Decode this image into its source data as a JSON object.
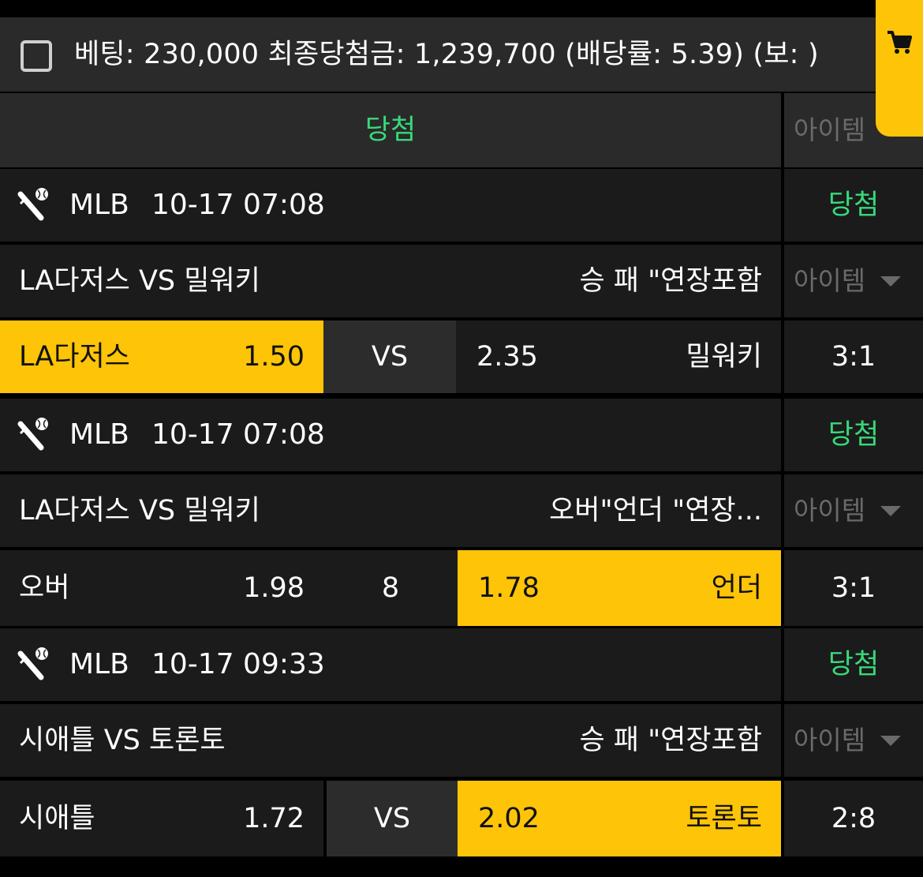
{
  "summary": {
    "text": "베팅: 230,000 최종당첨금: 1,239,700 (배당률: 5.39) (보: )"
  },
  "status_header": {
    "result_label": "당첨",
    "item_label": "아이템"
  },
  "colors": {
    "win_green": "#38d97a",
    "selected_yellow": "#fec407",
    "row_bg": "#1b1b1b",
    "header_bg": "#2a2a2a"
  },
  "bets": [
    {
      "league": "MLB",
      "datetime": "10-17 07:08",
      "result": "당첨",
      "match_title": "LA다저스 VS 밀워키",
      "market": "승 패 \"연장포함",
      "item_label": "아이템",
      "home_label": "LA다저스",
      "home_odds": "1.50",
      "mid_label": "VS",
      "away_odds": "2.35",
      "away_label": "밀워키",
      "score": "3:1",
      "selected": "home"
    },
    {
      "league": "MLB",
      "datetime": "10-17 07:08",
      "result": "당첨",
      "match_title": "LA다저스 VS 밀워키",
      "market": "오버\"언더 \"연장...",
      "item_label": "아이템",
      "home_label": "오버",
      "home_odds": "1.98",
      "mid_label": "8",
      "away_odds": "1.78",
      "away_label": "언더",
      "score": "3:1",
      "selected": "away"
    },
    {
      "league": "MLB",
      "datetime": "10-17 09:33",
      "result": "당첨",
      "match_title": "시애틀 VS 토론토",
      "market": "승 패 \"연장포함",
      "item_label": "아이템",
      "home_label": "시애틀",
      "home_odds": "1.72",
      "mid_label": "VS",
      "away_odds": "2.02",
      "away_label": "토론토",
      "score": "2:8",
      "selected": "away"
    }
  ]
}
